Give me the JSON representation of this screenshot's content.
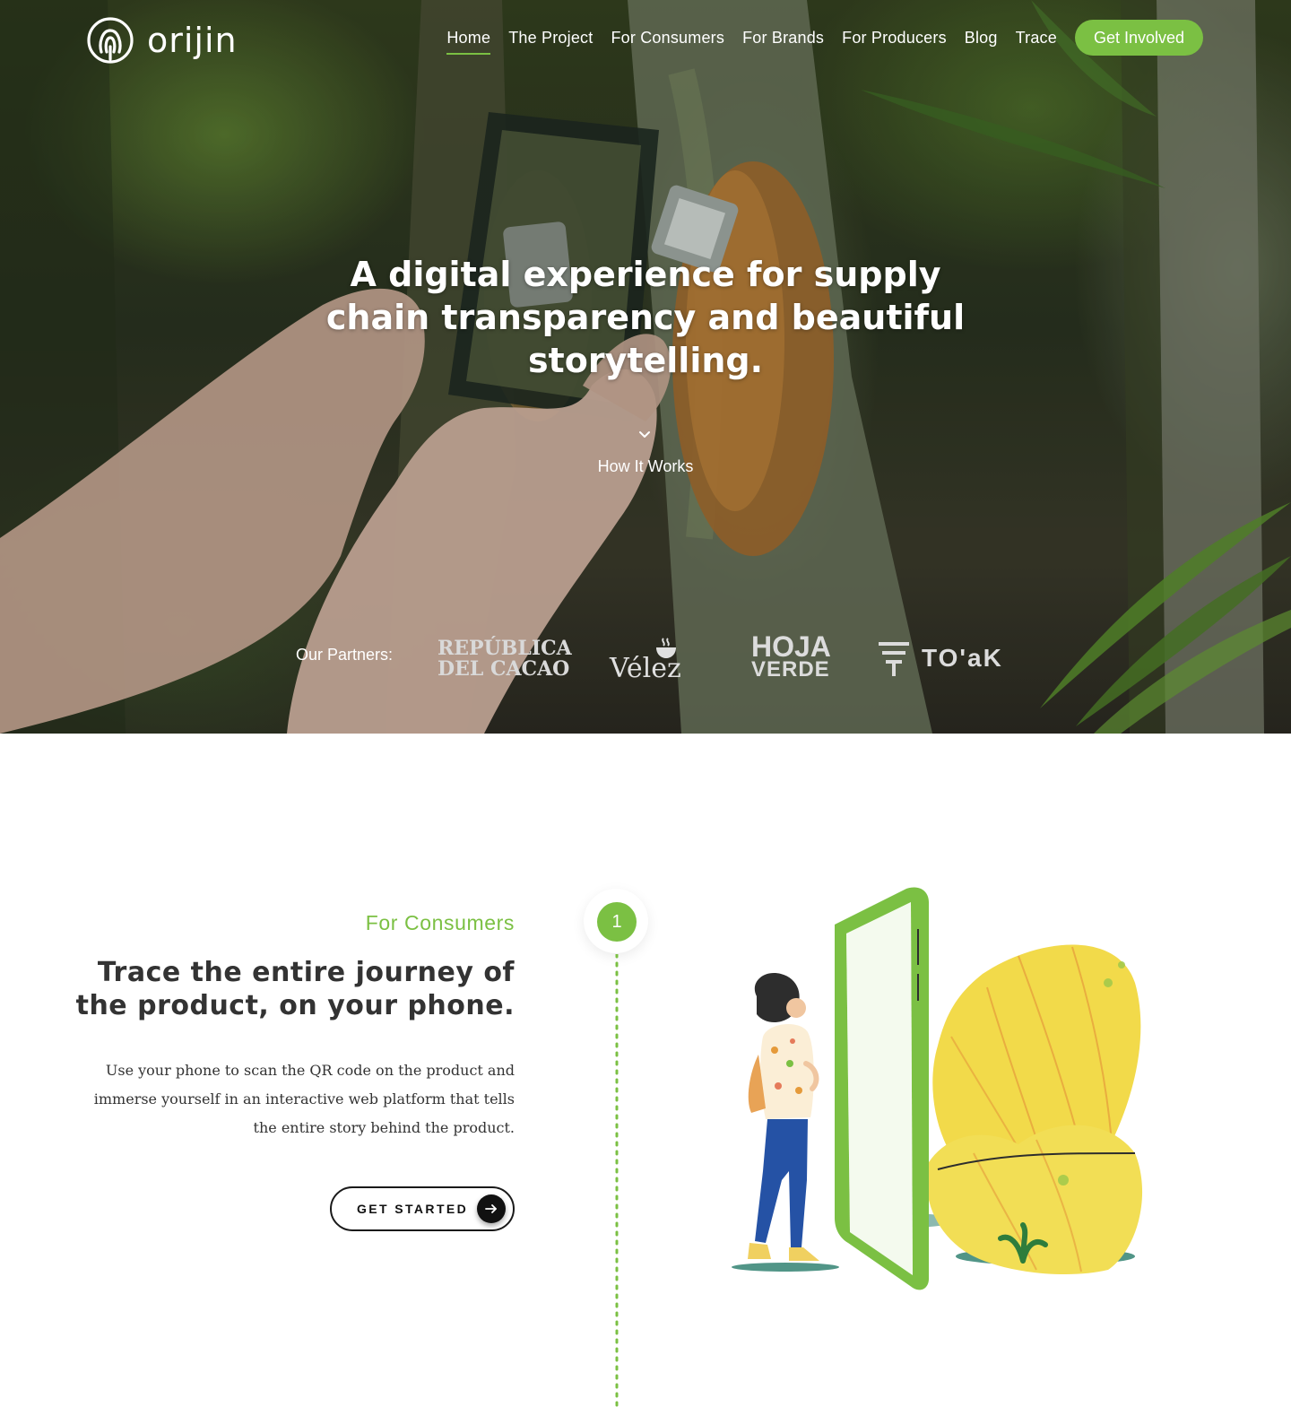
{
  "nav": {
    "brand": "orijin",
    "items": [
      {
        "label": "Home",
        "active": true
      },
      {
        "label": "The Project",
        "active": false
      },
      {
        "label": "For Consumers",
        "active": false
      },
      {
        "label": "For Brands",
        "active": false
      },
      {
        "label": "For Producers",
        "active": false
      },
      {
        "label": "Blog",
        "active": false
      },
      {
        "label": "Trace",
        "active": false
      }
    ],
    "cta": "Get Involved"
  },
  "hero": {
    "title": "A digital experience for supply chain transparency and beautiful storytelling.",
    "scroll_label": "How It Works",
    "partners_label": "Our Partners:",
    "partners": {
      "p1_line1": "REPÚBLICA",
      "p1_line2": "DEL CACAO",
      "p2": "Vélez",
      "p3_line1": "HOJA",
      "p3_line2": "VERDE",
      "p4": "TO'aK"
    }
  },
  "consumers": {
    "eyebrow": "For Consumers",
    "title": "Trace the entire journey of the product, on your phone.",
    "body": "Use your phone to scan the QR code on the product and immerse yourself in an interactive web platform that tells the entire story behind the product.",
    "cta": "GET STARTED",
    "step": "1"
  },
  "colors": {
    "accent": "#7bc043",
    "text_dark": "#333333",
    "button_dark": "#111111"
  },
  "icons": [
    "orijin-logo-icon",
    "chevron-down-icon",
    "arrow-right-icon"
  ]
}
